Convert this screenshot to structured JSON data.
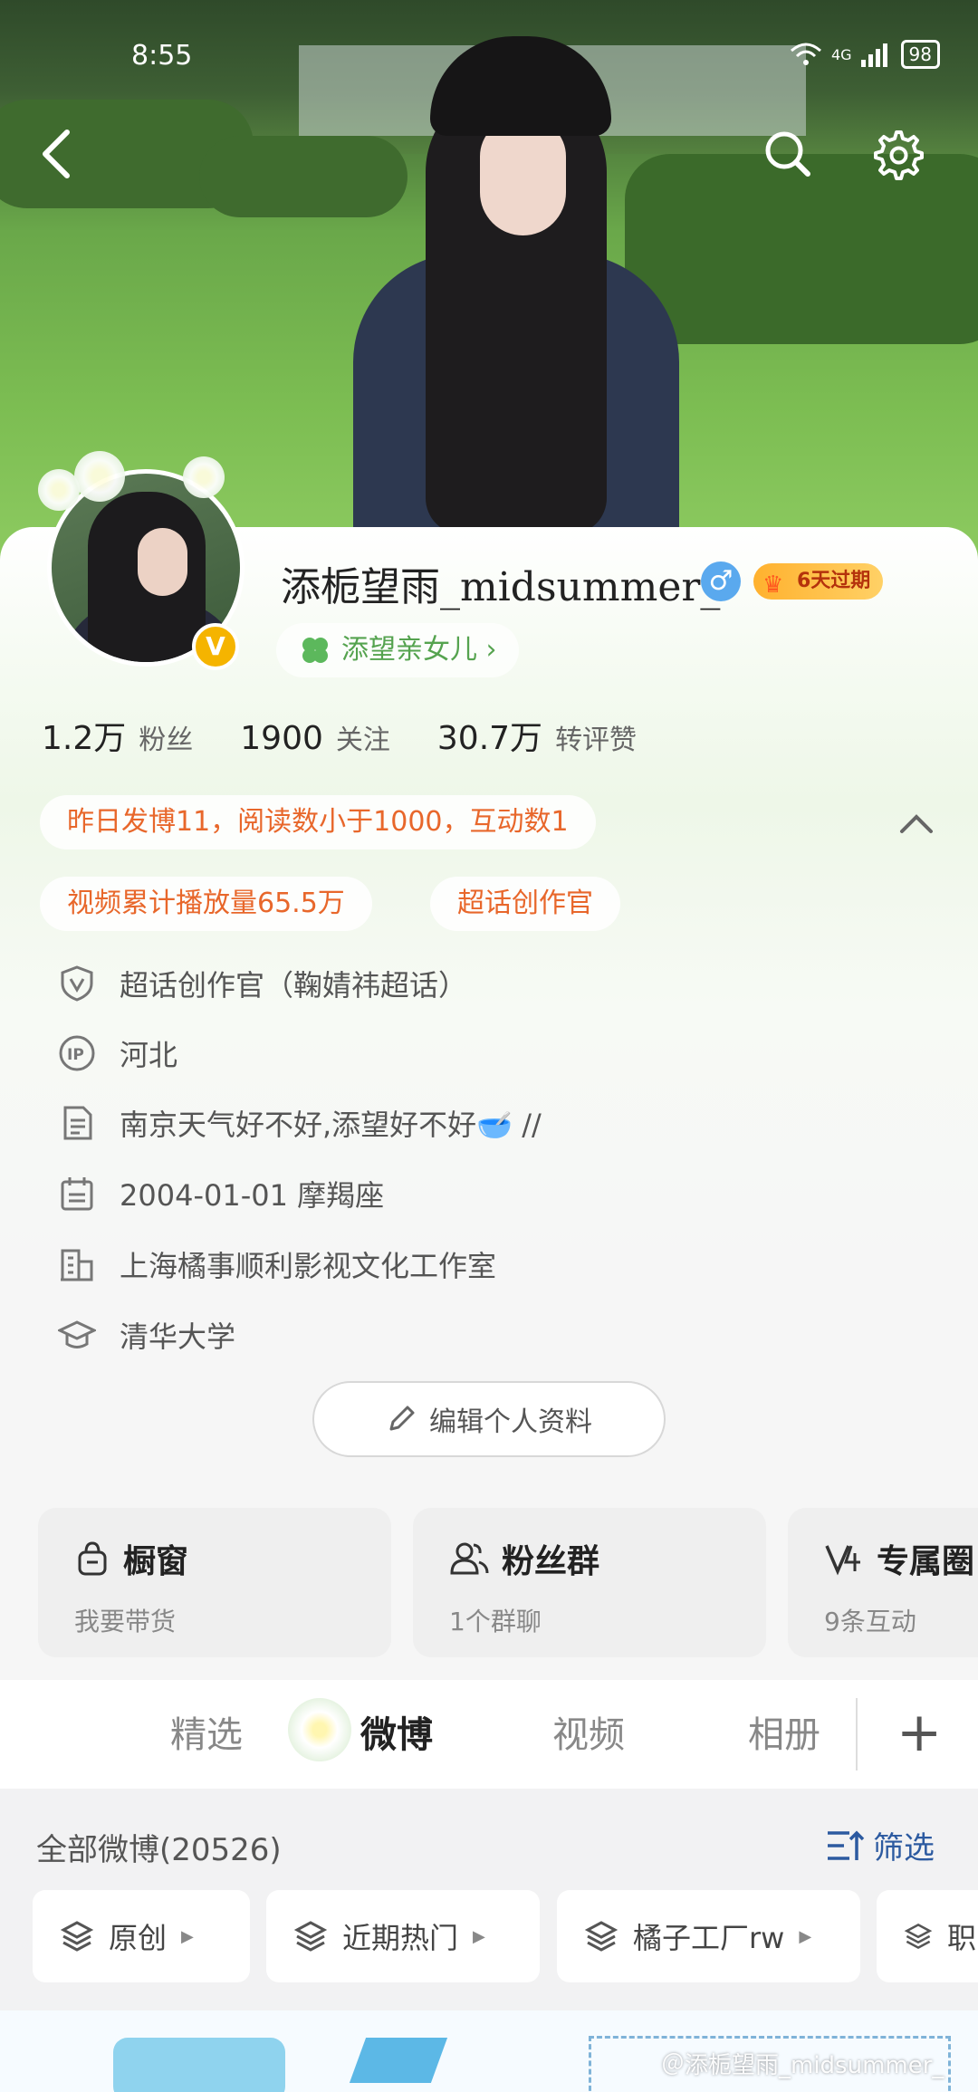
{
  "status_bar": {
    "time": "8:55",
    "network": "4G",
    "battery": "98"
  },
  "profile": {
    "username": "添栀望雨_midsummer_",
    "gender_symbol": "♂",
    "vip_text": "6天过期",
    "verified_badge": "V",
    "group_link": "添望亲女儿 ›",
    "stats": [
      {
        "number": "1.2万",
        "label": "粉丝"
      },
      {
        "number": "1900",
        "label": "关注"
      },
      {
        "number": "30.7万",
        "label": "转评赞"
      }
    ],
    "tags": {
      "daily": "昨日发博11，阅读数小于1000，互动数1",
      "video": "视频累计播放量65.5万",
      "supertopic": "超话创作官"
    },
    "info": [
      {
        "icon": "shield-v-icon",
        "text": "超话创作官（鞠婧祎超话）"
      },
      {
        "icon": "ip-icon",
        "text": "河北"
      },
      {
        "icon": "document-icon",
        "text": "南京天气好不好,添望好不好🥣 //"
      },
      {
        "icon": "calendar-icon",
        "text": "2004-01-01 摩羯座"
      },
      {
        "icon": "company-icon",
        "text": "上海橘事顺利影视文化工作室"
      },
      {
        "icon": "graduation-cap-icon",
        "text": "清华大学"
      }
    ],
    "edit_button": "编辑个人资料"
  },
  "feature_cards": [
    {
      "icon": "shop-bag-icon",
      "title": "橱窗",
      "subtitle": "我要带货"
    },
    {
      "icon": "fan-group-icon",
      "title": "粉丝群",
      "subtitle": "1个群聊"
    },
    {
      "icon": "exclusive-v-icon",
      "title": "专属圈",
      "subtitle": "9条互动"
    }
  ],
  "tabs": [
    {
      "label": "精选",
      "active": false
    },
    {
      "label": "微博",
      "active": true
    },
    {
      "label": "视频",
      "active": false
    },
    {
      "label": "相册",
      "active": false
    }
  ],
  "tab_add": "+",
  "feed": {
    "title": "全部微博(20526)",
    "filter_label": "筛选",
    "chips": [
      {
        "label": "原创"
      },
      {
        "label": "近期热门"
      },
      {
        "label": "橘子工厂rw"
      },
      {
        "label": "职"
      }
    ]
  },
  "watermark": "＠添栀望雨_midsummer_",
  "colors": {
    "accent_orange": "#e8672b",
    "link_blue": "#2c5aa0",
    "group_green": "#55a34f",
    "vip_gold": "#ffb12e"
  }
}
